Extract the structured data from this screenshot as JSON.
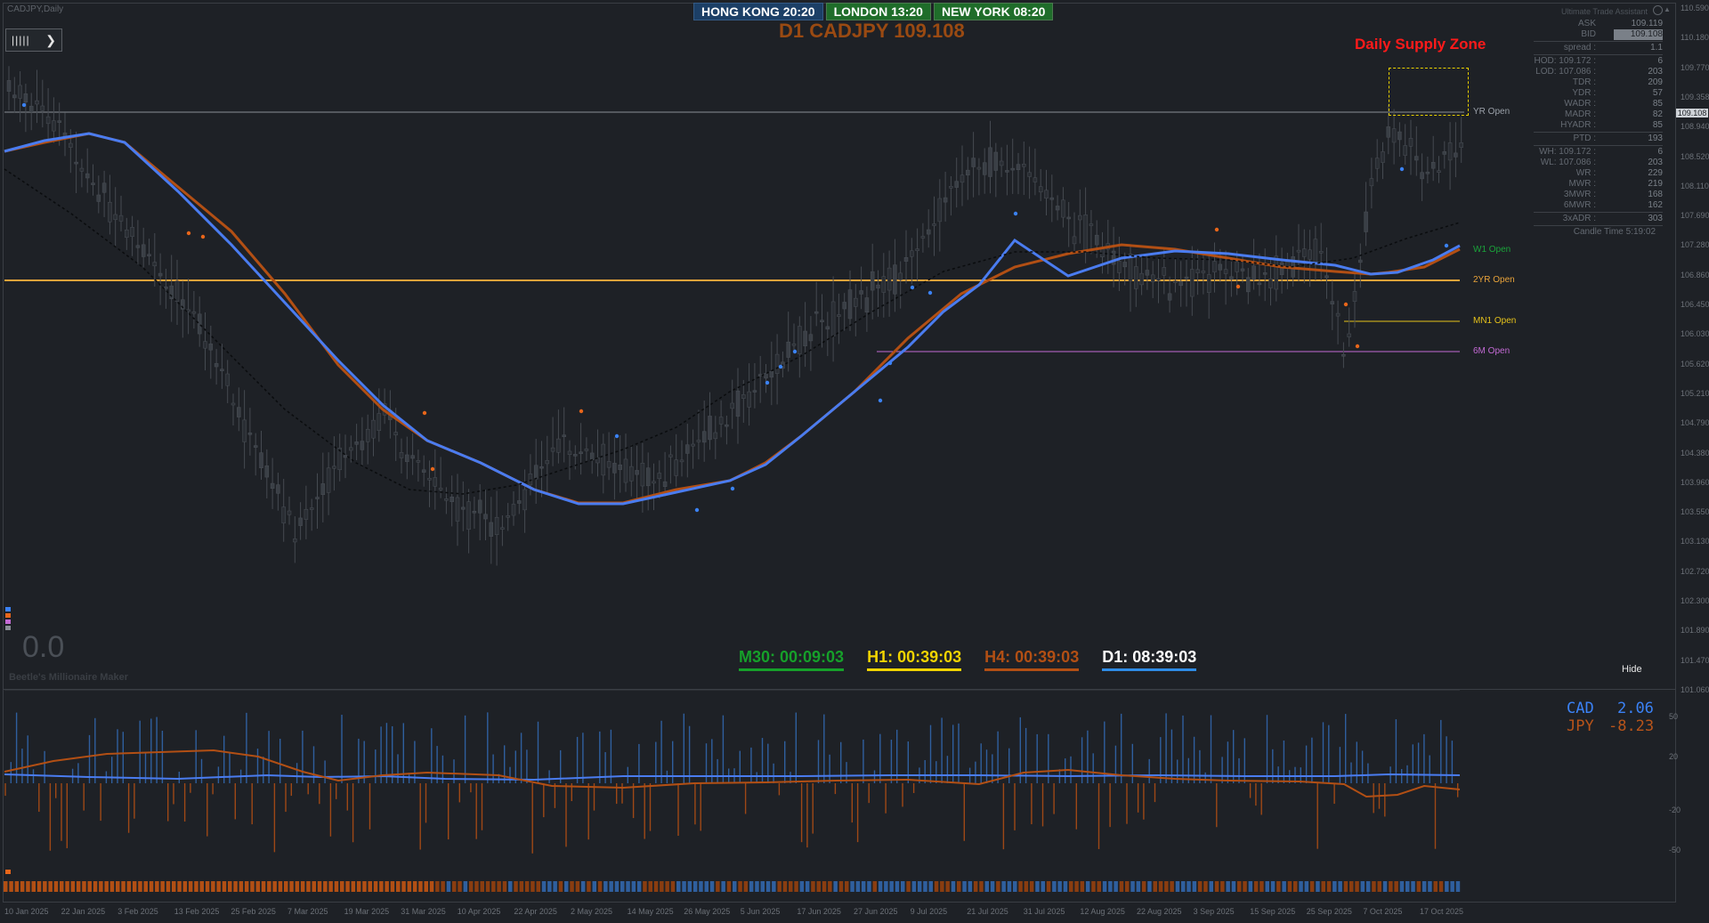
{
  "window_title": "CADJPY,Daily",
  "indicator_title": "Ultimate Trade Assistant",
  "sessions": [
    {
      "label": "HONG KONG 20:20",
      "key": "hk"
    },
    {
      "label": "LONDON  13:20",
      "key": "ldn"
    },
    {
      "label": "NEW YORK  08:20",
      "key": "ny"
    }
  ],
  "chart_title": "D1 CADJPY 109.108",
  "supply_zone_label": "Daily Supply Zone",
  "levels": {
    "yr_open": "YR Open",
    "w1_open": "W1 Open",
    "yr2_open": "2YR Open",
    "mn1_open": "MN1 Open",
    "m6_open": "6M Open"
  },
  "price_badge": "0.0",
  "watermark": "Beetle's Millionaire Maker",
  "hide_button": "Hide",
  "stats": {
    "ask_label": "ASK",
    "ask": "109.119",
    "bid_label": "BID",
    "bid": "109.108",
    "spread_label": "spread :",
    "spread": "1.1",
    "hod_label": "HOD: 109.172 :",
    "hod": "6",
    "lod_label": "LOD: 107.086 :",
    "lod": "203",
    "tdr_label": "TDR :",
    "tdr": "209",
    "ydr_label": "YDR :",
    "ydr": "57",
    "wadr_label": "WADR :",
    "wadr": "85",
    "madr_label": "MADR :",
    "madr": "82",
    "hyadr_label": "HYADR :",
    "hyadr": "85",
    "ptd_label": "PTD :",
    "ptd": "193",
    "wh_label": "WH: 109.172 :",
    "wh": "6",
    "wl_label": "WL: 107.086 :",
    "wl": "203",
    "wr_label": "WR :",
    "wr": "229",
    "mwr_label": "MWR :",
    "mwr": "219",
    "mwr3_label": "3MWR :",
    "mwr3": "168",
    "mwr6_label": "6MWR :",
    "mwr6": "162",
    "adr3_label": "3xADR :",
    "adr3": "303",
    "candle_time": "Candle Time  5:19:02"
  },
  "right_axis": [
    "110.590",
    "110.180",
    "109.770",
    "109.358",
    "108.940",
    "108.520",
    "108.110",
    "107.690",
    "107.280",
    "106.860",
    "106.450",
    "106.030",
    "105.620",
    "105.210",
    "104.790",
    "104.380",
    "103.960",
    "103.550",
    "103.130",
    "102.720",
    "102.300",
    "101.890",
    "101.470",
    "101.060"
  ],
  "current_price_tag": "109.108",
  "timers": [
    {
      "label": "M30: 00:09:03",
      "color": "#16a02a"
    },
    {
      "label": "H1: 00:39:03",
      "color": "#f2d400"
    },
    {
      "label": "H4: 00:39:03",
      "color": "#b24f14"
    },
    {
      "label": "D1: 08:39:03",
      "color": "#ffffff",
      "underline": "#2f8ce6"
    }
  ],
  "currency_strength": [
    {
      "code": "CAD",
      "value": "2.06",
      "color": "#3b82f6"
    },
    {
      "code": "JPY",
      "value": "-8.23",
      "color": "#b8541a"
    }
  ],
  "sub_axis": [
    "50",
    "20",
    "-20",
    "-50"
  ],
  "dates": [
    "10 Jan 2025",
    "22 Jan 2025",
    "3 Feb 2025",
    "13 Feb 2025",
    "25 Feb 2025",
    "7 Mar 2025",
    "19 Mar 2025",
    "31 Mar 2025",
    "10 Apr 2025",
    "22 Apr 2025",
    "2 May 2025",
    "14 May 2025",
    "26 May 2025",
    "5 Jun 2025",
    "17 Jun 2025",
    "27 Jun 2025",
    "9 Jul 2025",
    "21 Jul 2025",
    "31 Jul 2025",
    "12 Aug 2025",
    "22 Aug 2025",
    "3 Sep 2025",
    "15 Sep 2025",
    "25 Sep 2025",
    "7 Oct 2025",
    "17 Oct 2025"
  ],
  "colors": {
    "background": "#1e2126",
    "cad": "#3b82f6",
    "jpy": "#b8541a",
    "yr2": "#e8a33a",
    "mn1": "#e6c21a",
    "m6": "#c36ad4",
    "w1": "#1aa33a"
  }
}
